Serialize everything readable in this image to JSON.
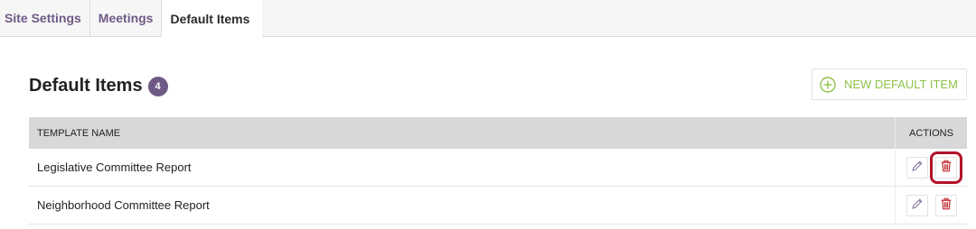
{
  "tabs": [
    {
      "label": "Site Settings"
    },
    {
      "label": "Meetings"
    },
    {
      "label": "Default Items"
    }
  ],
  "page": {
    "title": "Default Items",
    "count": "4"
  },
  "new_button": {
    "label": "NEW DEFAULT ITEM"
  },
  "table": {
    "columns": {
      "name": "TEMPLATE NAME",
      "actions": "ACTIONS"
    },
    "rows": [
      {
        "name": "Legislative Committee Report"
      },
      {
        "name": "Neighborhood Committee Report"
      }
    ]
  },
  "colors": {
    "brand": "#6f5a86",
    "accent_green": "#8fc24a",
    "delete_red": "#c0272d",
    "highlight": "#b3122a"
  },
  "icons": {
    "new": "plus-circle-icon",
    "edit": "pencil-icon",
    "delete": "trash-icon"
  }
}
